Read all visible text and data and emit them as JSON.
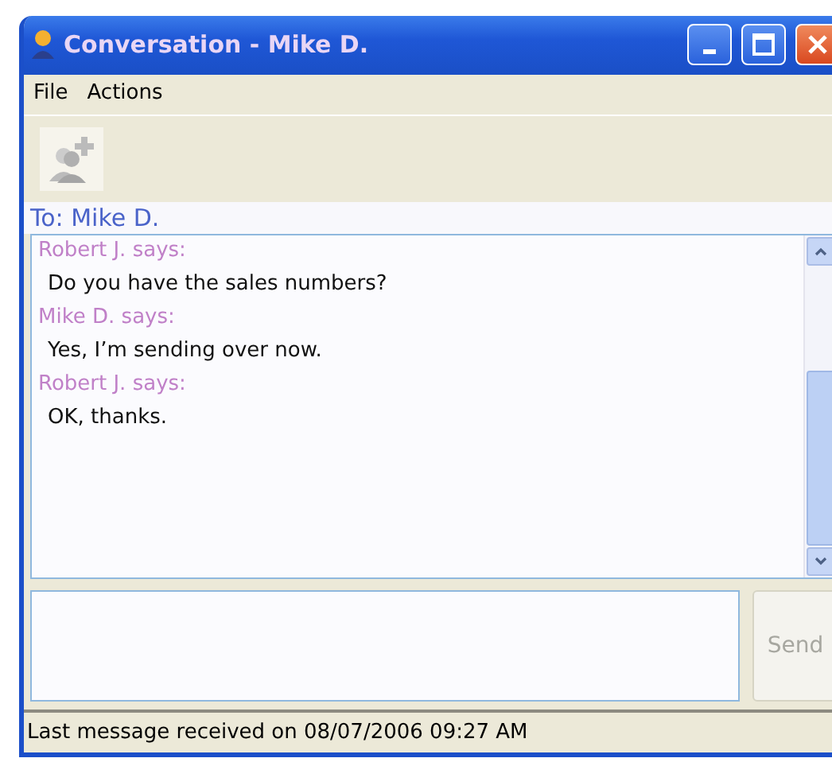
{
  "window": {
    "title": "Conversation - Mike D."
  },
  "menu": [
    "File",
    "Actions"
  ],
  "recipient": "To: Mike D.",
  "messages": [
    {
      "sender": "Robert J. says:",
      "text": "Do you have the sales numbers?"
    },
    {
      "sender": "Mike D. says:",
      "text": "Yes, I’m sending over now."
    },
    {
      "sender": "Robert J. says:",
      "text": "OK, thanks."
    }
  ],
  "send_button": {
    "label": "Send",
    "disabled": true
  },
  "status_bar": "Last message received on 08/07/2006 09:27 AM"
}
